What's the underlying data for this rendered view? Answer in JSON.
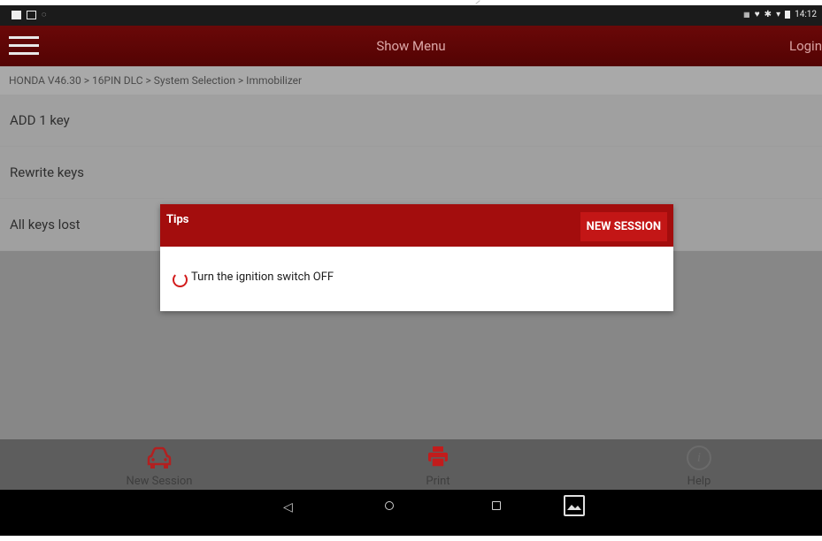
{
  "status_bar": {
    "time": "14:12"
  },
  "app_bar": {
    "title": "Show Menu",
    "login_label": "Login"
  },
  "breadcrumb": "HONDA V46.30 > 16PIN DLC > System Selection > Immobilizer",
  "menu": {
    "items": [
      {
        "label": "ADD 1 key"
      },
      {
        "label": "Rewrite keys"
      },
      {
        "label": "All keys lost"
      }
    ]
  },
  "dialog": {
    "title": "Tips",
    "button_label": "NEW SESSION",
    "message": "Turn the ignition switch OFF"
  },
  "toolbar": {
    "new_session_label": "New Session",
    "print_label": "Print",
    "help_label": "Help"
  },
  "colors": {
    "app_bar": "#5e0505",
    "dialog_header": "#a30d0d",
    "accent": "#c31616"
  }
}
